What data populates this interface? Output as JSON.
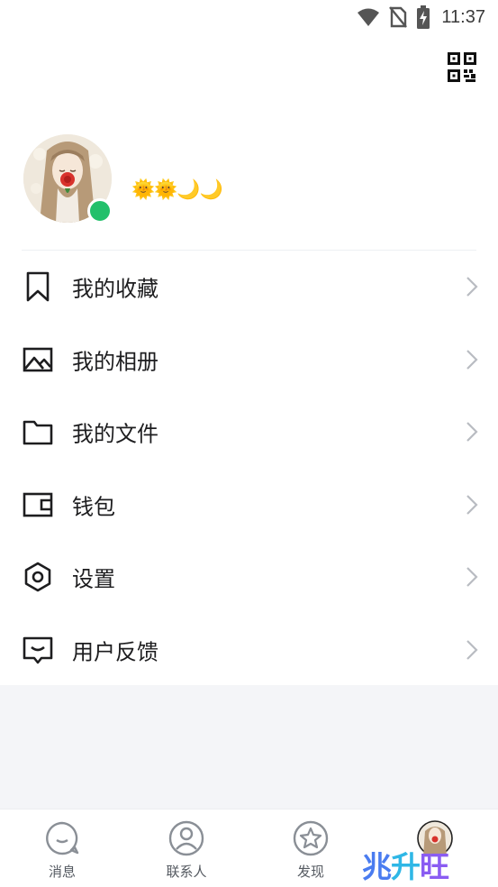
{
  "status_bar": {
    "time": "11:37",
    "icons": [
      "wifi-icon",
      "no-sim-icon",
      "battery-charging-icon"
    ]
  },
  "header": {
    "qr_icon": "qr-code-icon"
  },
  "profile": {
    "avatar": "avatar",
    "online_color": "#22c06b",
    "status_emoji": "🌞🌞🌙🌙"
  },
  "menu": {
    "items": [
      {
        "label": "我的收藏",
        "icon": "bookmark-icon"
      },
      {
        "label": "我的相册",
        "icon": "image-icon"
      },
      {
        "label": "我的文件",
        "icon": "folder-icon"
      },
      {
        "label": "钱包",
        "icon": "wallet-icon"
      },
      {
        "label": "设置",
        "icon": "settings-hexagon-icon"
      },
      {
        "label": "用户反馈",
        "icon": "feedback-icon"
      }
    ]
  },
  "tabbar": {
    "tabs": [
      {
        "label": "消息",
        "icon": "chat-bubble-icon"
      },
      {
        "label": "联系人",
        "icon": "person-icon"
      },
      {
        "label": "发现",
        "icon": "star-compass-icon"
      },
      {
        "label": "",
        "icon": "avatar-icon"
      }
    ]
  },
  "watermark": {
    "text1": "兆",
    "text2": "升",
    "text3": "旺"
  },
  "colors": {
    "accent_green": "#22c06b",
    "background": "#f4f5f8",
    "text": "#1d1d1f"
  }
}
